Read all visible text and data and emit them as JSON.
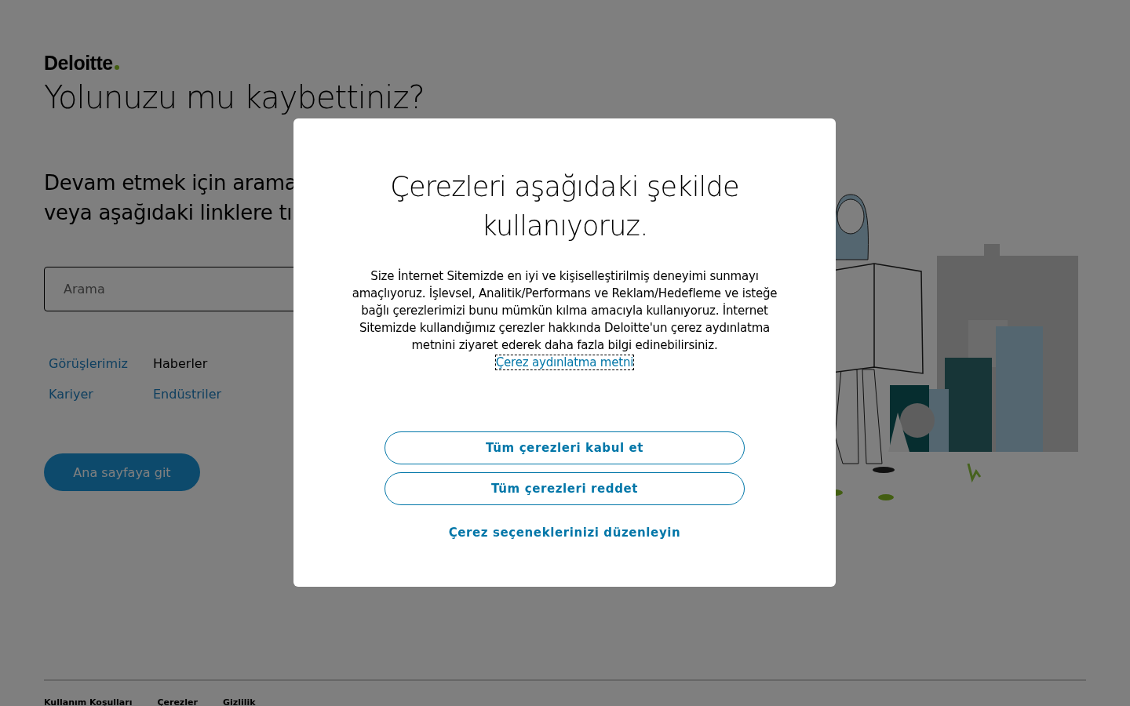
{
  "logo": {
    "text": "Deloitte"
  },
  "page": {
    "heading": "Yolunuzu mu kaybettiniz?",
    "intro": [
      "Devam etmek için arama",
      "veya aşağıdaki linklere tı"
    ],
    "search": {
      "placeholder": "Arama"
    },
    "links": [
      {
        "label": "Görüşlerimiz",
        "active": false
      },
      {
        "label": "Haberler",
        "active": true
      },
      {
        "label": "Kariyer",
        "active": false
      },
      {
        "label": "Endüstriler",
        "active": false
      }
    ],
    "home_button": "Ana sayfaya git"
  },
  "footer": {
    "links": [
      "Kullanım Koşulları",
      "Çerezler",
      "Gizlilik"
    ]
  },
  "cookie_dialog": {
    "title": "Çerezleri aşağıdaki şekilde kullanıyoruz.",
    "body": "Size İnternet Sitemizde en iyi ve kişiselleştirilmiş deneyimi sunmayı amaçlıyoruz. İşlevsel, Analitik/Performans ve Reklam/Hedefleme ve isteğe bağlı çerezlerimizi bunu mümkün kılma amacıyla kullanıyoruz. İnternet Sitemizde kullandığımız çerezler hakkında Deloitte'un çerez aydınlatma metnini ziyaret ederek daha fazla bilgi edinebilirsiniz.",
    "link": "Çerez aydınlatma metni",
    "buttons": [
      {
        "label": "Tüm çerezleri kabul et",
        "kind": "outline"
      },
      {
        "label": "Tüm çerezleri reddet",
        "kind": "outline"
      },
      {
        "label": "Çerez seçeneklerinizi düzenleyin",
        "kind": "text"
      }
    ]
  }
}
